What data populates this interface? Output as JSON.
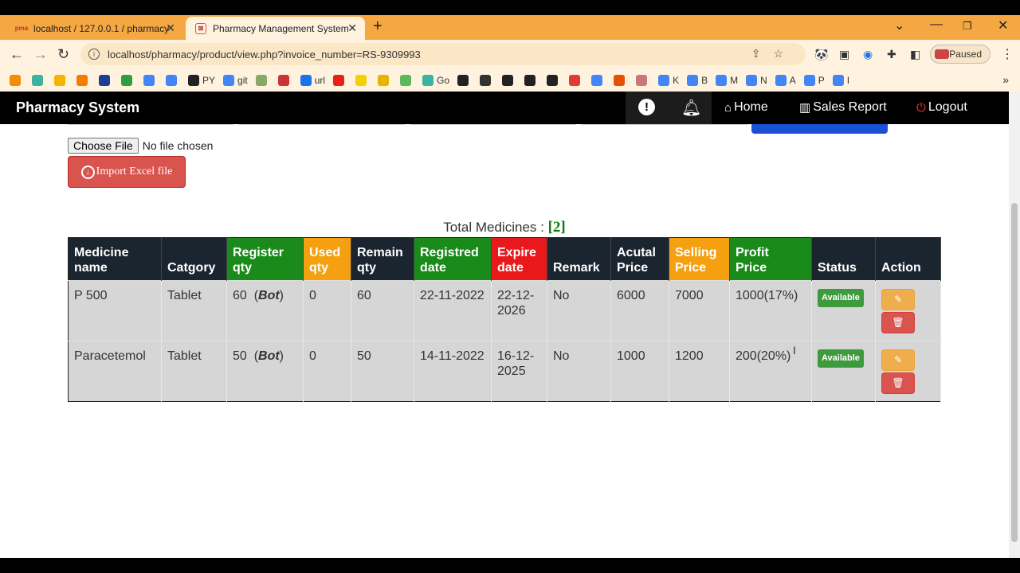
{
  "browser": {
    "tabs": [
      {
        "label": "localhost / 127.0.0.1 / pharmacy",
        "icon": "pma-icon"
      },
      {
        "label": "Pharmacy Management System",
        "icon": "pharmacy-icon"
      }
    ],
    "url": "localhost/pharmacy/product/view.php?invoice_number=RS-9309993",
    "profile_status": "Paused",
    "bookmarks": [
      {
        "label": "",
        "color": "#f48c06"
      },
      {
        "label": "",
        "color": "#3bb3a0"
      },
      {
        "label": "",
        "color": "#f5b400"
      },
      {
        "label": "",
        "color": "#f57c00"
      },
      {
        "label": "",
        "color": "#1c3f94"
      },
      {
        "label": "",
        "color": "#2e9e3e"
      },
      {
        "label": "",
        "color": "#4285f4"
      },
      {
        "label": "",
        "color": "#4285f4"
      },
      {
        "label": "PY",
        "color": "#222222"
      },
      {
        "label": "git",
        "color": "#4285f4"
      },
      {
        "label": "",
        "color": "#8a6"
      },
      {
        "label": "",
        "color": "#c33"
      },
      {
        "label": "url",
        "color": "#1a73e8"
      },
      {
        "label": "",
        "color": "#e62117"
      },
      {
        "label": "",
        "color": "#f5d000"
      },
      {
        "label": "",
        "color": "#e8b400"
      },
      {
        "label": "",
        "color": "#5cb85c"
      },
      {
        "label": "Go",
        "color": "#3bb3a0"
      },
      {
        "label": "",
        "color": "#222"
      },
      {
        "label": "",
        "color": "#333"
      },
      {
        "label": "",
        "color": "#222"
      },
      {
        "label": "",
        "color": "#222"
      },
      {
        "label": "",
        "color": "#222"
      },
      {
        "label": "",
        "color": "#e53935"
      },
      {
        "label": "",
        "color": "#4285f4"
      },
      {
        "label": "",
        "color": "#e65100"
      },
      {
        "label": "",
        "color": "#c77"
      },
      {
        "label": "K",
        "color": "#4285f4"
      },
      {
        "label": "B",
        "color": "#4285f4"
      },
      {
        "label": "M",
        "color": "#4285f4"
      },
      {
        "label": "N",
        "color": "#4285f4"
      },
      {
        "label": "A",
        "color": "#4285f4"
      },
      {
        "label": "P",
        "color": "#4285f4"
      },
      {
        "label": "I",
        "color": "#4285f4"
      }
    ]
  },
  "navbar": {
    "brand": "Pharmacy System",
    "home": "Home",
    "sales_report": "Sales Report",
    "logout": "Logout"
  },
  "upload": {
    "choose_label": "Choose File",
    "no_file": "No file chosen",
    "import_label": "Import Excel file"
  },
  "summary": {
    "label": "Total Medicines :",
    "count": "[2]"
  },
  "table": {
    "headers": [
      {
        "line1": "Medicine",
        "line2": "name"
      },
      {
        "line1": "",
        "line2": "Catgory"
      },
      {
        "line1": "Register",
        "line2": "qty"
      },
      {
        "line1": "Used",
        "line2": "qty"
      },
      {
        "line1": "Remain",
        "line2": "qty"
      },
      {
        "line1": "Registred",
        "line2": "date"
      },
      {
        "line1": "Expire",
        "line2": "date"
      },
      {
        "line1": "",
        "line2": "Remark"
      },
      {
        "line1": "Acutal",
        "line2": "Price"
      },
      {
        "line1": "Selling",
        "line2": "Price"
      },
      {
        "line1": "Profit",
        "line2": "Price"
      },
      {
        "line1": "",
        "line2": "Status"
      },
      {
        "line1": "",
        "line2": "Action"
      }
    ],
    "rows": [
      {
        "name": "P 500",
        "category": "Tablet",
        "register_qty": "60",
        "unit": "Bot",
        "used_qty": "0",
        "remain_qty": "60",
        "registered_date": "22-11-2022",
        "expire_date": "22-12-2026",
        "remark": "No",
        "actual_price": "6000",
        "selling_price": "7000",
        "profit": "1000(17%)",
        "status": "Available"
      },
      {
        "name": "Paracetemol",
        "category": "Tablet",
        "register_qty": "50",
        "unit": "Bot",
        "used_qty": "0",
        "remain_qty": "50",
        "registered_date": "14-11-2022",
        "expire_date": "16-12-2025",
        "remark": "No",
        "actual_price": "1000",
        "selling_price": "1200",
        "profit": "200(20%)",
        "status": "Available"
      }
    ]
  }
}
